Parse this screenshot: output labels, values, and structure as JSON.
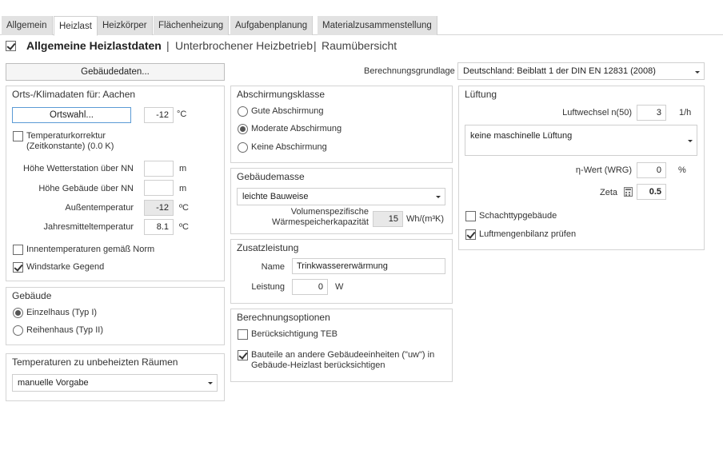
{
  "tabs": [
    "Allgemein",
    "Heizlast",
    "Heizkörper",
    "Flächenheizung",
    "Aufgabenplanung",
    "Materialzusammenstellung"
  ],
  "subheader": {
    "checked": true,
    "title": "Allgemeine Heizlastdaten",
    "sep1": "|",
    "link1": "Unterbrochener Heizbetrieb",
    "sep2": "|",
    "link2": "Raumübersicht"
  },
  "gebaeudedaten_button": "Gebäudedaten...",
  "berechnungsgrundlage": {
    "label": "Berechnungsgrundlage",
    "value": "Deutschland: Beiblatt 1 der DIN EN 12831 (2008)"
  },
  "orts": {
    "title": "Orts-/Klimadaten für: Aachen",
    "ortswahl_button": "Ortswahl...",
    "temp_value": "-12",
    "temp_unit": "°C",
    "temperaturkorrektur_line1": "Temperaturkorrektur",
    "temperaturkorrektur_line2": "(Zeitkonstante) (0.0 K)",
    "temperaturkorrektur_checked": false,
    "hoehe_wetter_label": "Höhe Wetterstation über NN",
    "hoehe_wetter_value": "",
    "hoehe_wetter_unit": "m",
    "hoehe_gebaeude_label": "Höhe Gebäude über NN",
    "hoehe_gebaeude_value": "",
    "hoehe_gebaeude_unit": "m",
    "aussen_label": "Außentemperatur",
    "aussen_value": "-12",
    "aussen_unit": "ºC",
    "jahres_label": "Jahresmitteltemperatur",
    "jahres_value": "8.1",
    "jahres_unit": "ºC",
    "innen_label": "Innentemperaturen gemäß Norm",
    "innen_checked": false,
    "wind_label": "Windstarke Gegend",
    "wind_checked": true
  },
  "gebaeude": {
    "title": "Gebäude",
    "options": [
      {
        "label": "Einzelhaus (Typ I)",
        "checked": true
      },
      {
        "label": "Reihenhaus (Typ II)",
        "checked": false
      }
    ]
  },
  "temperaturen": {
    "title": "Temperaturen zu unbeheizten Räumen",
    "value": "manuelle Vorgabe"
  },
  "abschirmung": {
    "title": "Abschirmungsklasse",
    "options": [
      {
        "label": "Gute Abschirmung",
        "checked": false
      },
      {
        "label": "Moderate Abschirmung",
        "checked": true
      },
      {
        "label": "Keine Abschirmung",
        "checked": false
      }
    ]
  },
  "gebaeudemasse": {
    "title": "Gebäudemasse",
    "value": "leichte Bauweise",
    "vol_line1": "Volumenspezifische",
    "vol_line2": "Wärmespeicherkapazität",
    "vol_value": "15",
    "vol_unit": "Wh/(m³K)"
  },
  "zusatz": {
    "title": "Zusatzleistung",
    "name_label": "Name",
    "name_value": "Trinkwassererwärmung",
    "leistung_label": "Leistung",
    "leistung_value": "0",
    "leistung_unit": "W"
  },
  "optionen": {
    "title": "Berechnungsoptionen",
    "teb_label": "Berücksichtigung TEB",
    "teb_checked": false,
    "uw_line1": "Bauteile an andere Gebäudeeinheiten (\"uw\") in",
    "uw_line2": "Gebäude-Heizlast berücksichtigen",
    "uw_checked": true
  },
  "lueftung": {
    "title": "Lüftung",
    "luftwechsel_label": "Luftwechsel n(50)",
    "luftwechsel_value": "3",
    "luftwechsel_unit": "1/h",
    "maschinell_value": "keine maschinelle Lüftung",
    "eta_label": "η-Wert (WRG)",
    "eta_value": "0",
    "eta_unit": "%",
    "zeta_label": "Zeta",
    "zeta_value": "0.5",
    "schacht_label": "Schachttypgebäude",
    "schacht_checked": false,
    "bilanz_label": "Luftmengenbilanz prüfen",
    "bilanz_checked": true
  }
}
